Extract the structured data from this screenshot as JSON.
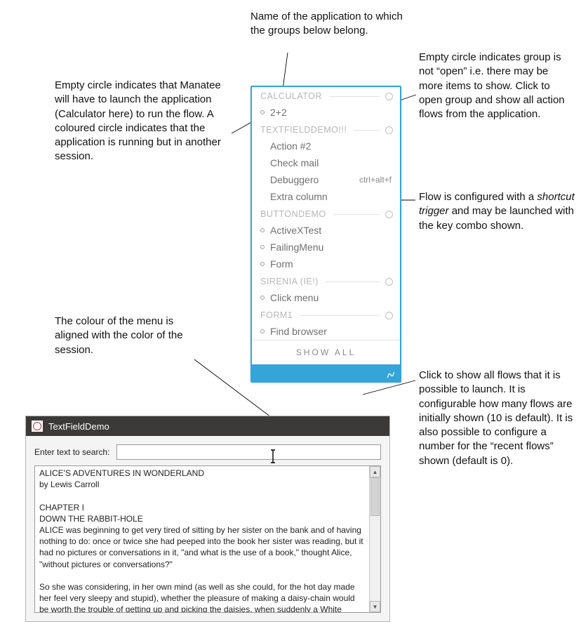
{
  "annotations": {
    "app_name": "Name of the application to which the groups below belong.",
    "empty_circle_left": "Empty circle indicates that Manatee will have to launch the application (Calculator here) to run the flow. A coloured circle indicates that the application is running but in another session.",
    "empty_circle_right": "Empty circle indicates group is not “open” i.e. there may be more items to show. Click to open group and show all action flows from the application.",
    "shortcut": "Flow is configured with a shortcut trigger and may be launched with the key combo shown.",
    "menu_color": "The colour of the menu is aligned with the color of the session.",
    "show_all": "Click to show all flows that it is possible to launch. It is configurable how many flows are initially shown (10 is default). It is also possible to configure a number for the “recent flows” shown (default is 0)."
  },
  "menu": {
    "groups": [
      {
        "name": "CALCULATOR",
        "flows": [
          {
            "label": "2+2",
            "has_dot": true
          }
        ]
      },
      {
        "name": "TEXTFIELDDEMO!!!",
        "flows": [
          {
            "label": "Action #2",
            "has_dot": false
          },
          {
            "label": "Check mail",
            "has_dot": false
          },
          {
            "label": "Debuggero",
            "has_dot": false,
            "shortcut": "ctrl+alt+f"
          },
          {
            "label": "Extra column",
            "has_dot": false
          }
        ]
      },
      {
        "name": "BUTTONDEMO",
        "flows": [
          {
            "label": "ActiveXTest",
            "has_dot": true
          },
          {
            "label": "FailingMenu",
            "has_dot": true
          },
          {
            "label": "Form",
            "has_dot": true
          }
        ]
      },
      {
        "name": "SIRENIA (IE!)",
        "flows": [
          {
            "label": "Click menu",
            "has_dot": true
          }
        ]
      },
      {
        "name": "FORM1",
        "flows": [
          {
            "label": "Find browser",
            "has_dot": true
          }
        ]
      }
    ],
    "show_all_label": "SHOW  ALL"
  },
  "window": {
    "title": "TextFieldDemo",
    "search_label": "Enter text to search:",
    "search_value": "",
    "text_content": "ALICE'S ADVENTURES IN WONDERLAND\nby Lewis Carroll\n\nCHAPTER I\nDOWN THE RABBIT-HOLE\nALICE was beginning to get very tired of sitting by her sister on the bank and of having nothing to do: once or twice she had peeped into the book her sister was reading, but it had no pictures or conversations in it, \"and what is the use of a book,\" thought Alice, \"without pictures or conversations?\"\n\nSo she was considering, in her own mind (as well as she could, for the hot day made her feel very sleepy and stupid), whether the pleasure of making a daisy-chain would be worth the trouble of getting up and picking the daisies, when suddenly a White Rabbit with pink eyes ran close by her."
  }
}
